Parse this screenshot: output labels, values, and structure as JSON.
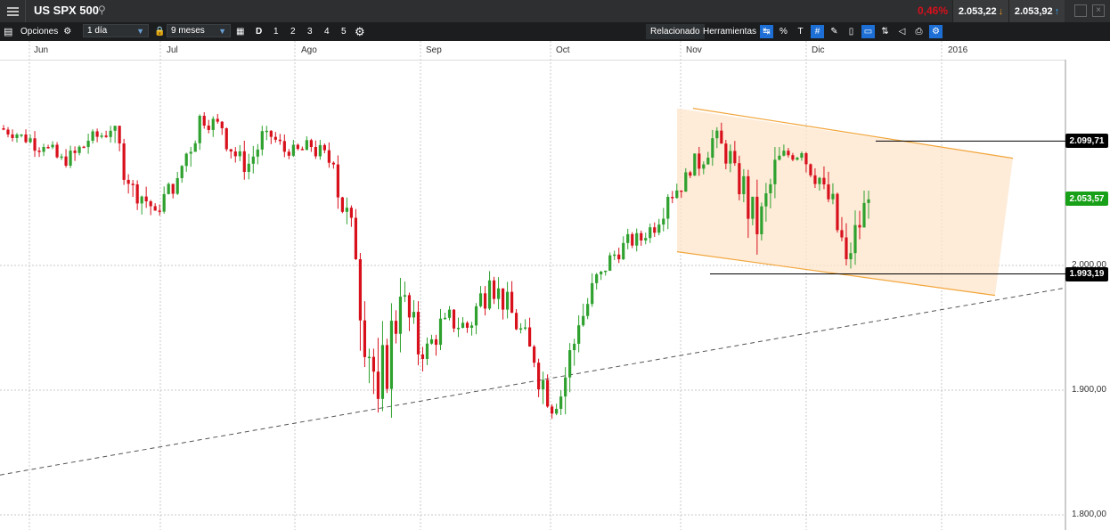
{
  "topbar": {
    "instrument": "US SPX 500",
    "change_pct": "0,46%",
    "sell_price": "2.053,22",
    "buy_price": "2.053,92"
  },
  "toolbar": {
    "options_label": "Opciones",
    "interval": "1 día",
    "range": "9 meses",
    "d_label": "D",
    "layouts": [
      "1",
      "2",
      "3",
      "4",
      "5"
    ],
    "related_label": "Relacionado",
    "tools_label": "Herramientas"
  },
  "chart": {
    "months": [
      "Jun",
      "Jul",
      "Ago",
      "Sep",
      "Oct",
      "Nov",
      "Dic",
      "2016"
    ],
    "price_ticks": [
      "2.000,00",
      "1.900,00",
      "1.800,00"
    ],
    "labels": {
      "resistance": "2.099,71",
      "current": "2.053,57",
      "support": "1.993,19"
    },
    "colors": {
      "up": "#2ea12e",
      "down": "#d8101c",
      "channel_fill": "#fde6cc",
      "channel_line": "#f2a53a",
      "current_label": "#18a018"
    }
  },
  "chart_data": {
    "type": "candlestick",
    "title": "US SPX 500",
    "ylim": [
      1785,
      2150
    ],
    "y_ticks": [
      1800,
      1900,
      2000
    ],
    "x_categories": [
      "Jun",
      "Jul",
      "Ago",
      "Sep",
      "Oct",
      "Nov",
      "Dic",
      "2016"
    ],
    "weekly_ohlc": [
      {
        "o": 2110,
        "h": 2120,
        "l": 2097,
        "c": 2105
      },
      {
        "o": 2105,
        "h": 2118,
        "l": 2087,
        "c": 2095
      },
      {
        "o": 2095,
        "h": 2110,
        "l": 2078,
        "c": 2080
      },
      {
        "o": 2080,
        "h": 2112,
        "l": 2070,
        "c": 2100
      },
      {
        "o": 2100,
        "h": 2114,
        "l": 2088,
        "c": 2108
      },
      {
        "o": 2108,
        "h": 2112,
        "l": 2055,
        "c": 2065
      },
      {
        "o": 2065,
        "h": 2085,
        "l": 2040,
        "c": 2044
      },
      {
        "o": 2044,
        "h": 2075,
        "l": 2040,
        "c": 2070
      },
      {
        "o": 2070,
        "h": 2128,
        "l": 2062,
        "c": 2120
      },
      {
        "o": 2120,
        "h": 2130,
        "l": 2100,
        "c": 2110
      },
      {
        "o": 2110,
        "h": 2115,
        "l": 2068,
        "c": 2075
      },
      {
        "o": 2075,
        "h": 2112,
        "l": 2068,
        "c": 2108
      },
      {
        "o": 2108,
        "h": 2112,
        "l": 2082,
        "c": 2088
      },
      {
        "o": 2088,
        "h": 2105,
        "l": 2075,
        "c": 2095
      },
      {
        "o": 2095,
        "h": 2105,
        "l": 2070,
        "c": 2081
      },
      {
        "o": 2081,
        "h": 2090,
        "l": 2000,
        "c": 2005
      },
      {
        "o": 2005,
        "h": 2010,
        "l": 1867,
        "c": 1893
      },
      {
        "o": 1893,
        "h": 1990,
        "l": 1870,
        "c": 1975
      },
      {
        "o": 1975,
        "h": 1992,
        "l": 1915,
        "c": 1925
      },
      {
        "o": 1925,
        "h": 1965,
        "l": 1918,
        "c": 1958
      },
      {
        "o": 1958,
        "h": 1980,
        "l": 1938,
        "c": 1950
      },
      {
        "o": 1950,
        "h": 2000,
        "l": 1940,
        "c": 1988
      },
      {
        "o": 1988,
        "h": 1992,
        "l": 1945,
        "c": 1962
      },
      {
        "o": 1962,
        "h": 1965,
        "l": 1910,
        "c": 1922
      },
      {
        "o": 1922,
        "h": 1935,
        "l": 1872,
        "c": 1885
      },
      {
        "o": 1885,
        "h": 1960,
        "l": 1880,
        "c": 1952
      },
      {
        "o": 1952,
        "h": 2005,
        "l": 1948,
        "c": 1995
      },
      {
        "o": 1995,
        "h": 2025,
        "l": 1990,
        "c": 2018
      },
      {
        "o": 2018,
        "h": 2032,
        "l": 2005,
        "c": 2022
      },
      {
        "o": 2022,
        "h": 2062,
        "l": 2018,
        "c": 2055
      },
      {
        "o": 2055,
        "h": 2078,
        "l": 2045,
        "c": 2072
      },
      {
        "o": 2072,
        "h": 2112,
        "l": 2065,
        "c": 2102
      },
      {
        "o": 2102,
        "h": 2115,
        "l": 2070,
        "c": 2082
      },
      {
        "o": 2082,
        "h": 2088,
        "l": 2005,
        "c": 2025
      },
      {
        "o": 2025,
        "h": 2095,
        "l": 2020,
        "c": 2088
      },
      {
        "o": 2088,
        "h": 2100,
        "l": 2075,
        "c": 2090
      },
      {
        "o": 2090,
        "h": 2108,
        "l": 2060,
        "c": 2065
      },
      {
        "o": 2065,
        "h": 2080,
        "l": 2000,
        "c": 2005
      },
      {
        "o": 2005,
        "h": 2060,
        "l": 1995,
        "c": 2053
      }
    ],
    "annotations": {
      "resistance_level": 2099.71,
      "support_level": 1993.19,
      "current_price": 2053.57,
      "channel_upper": [
        2126,
        2086
      ],
      "channel_lower": [
        2011,
        1976
      ],
      "dashed_trendline": [
        1832,
        1982
      ]
    }
  }
}
